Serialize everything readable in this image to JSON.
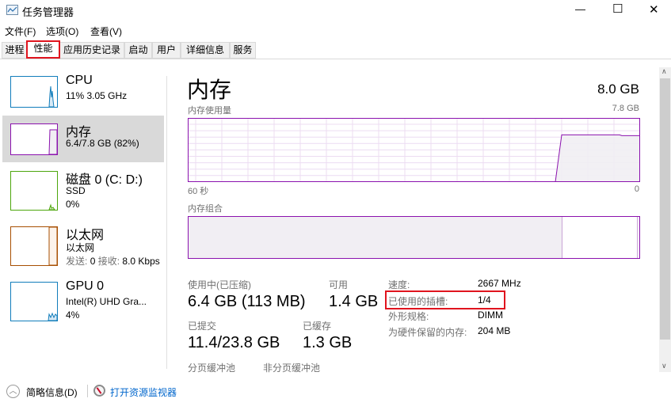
{
  "window": {
    "title": "任务管理器",
    "minimize": "—",
    "maximize": "☐",
    "close": "✕"
  },
  "menu": [
    "文件(F)",
    "选项(O)",
    "查看(V)"
  ],
  "tabs": [
    "进程",
    "性能",
    "应用历史记录",
    "启动",
    "用户",
    "详细信息",
    "服务"
  ],
  "sidebar": [
    {
      "title": "CPU",
      "sub": "11% 3.05 GHz",
      "color": "#117dbb"
    },
    {
      "title": "内存",
      "sub": "6.4/7.8 GB (82%)",
      "color": "#8b12ae"
    },
    {
      "title": "磁盘 0 (C: D:)",
      "sub": "SSD",
      "sub2": "0%",
      "color": "#4da60c"
    },
    {
      "title": "以太网",
      "sub": "以太网",
      "sub2_label1": "发送:",
      "sub2_val1": "0",
      "sub2_label2": "接收:",
      "sub2_val2": "8.0 Kbps",
      "color": "#a74f01"
    },
    {
      "title": "GPU 0",
      "sub": "Intel(R) UHD Gra...",
      "sub2": "4%",
      "color": "#117dbb"
    }
  ],
  "main": {
    "title": "内存",
    "total": "8.0 GB",
    "usage_label": "内存使用量",
    "usage_max": "7.8 GB",
    "time_left": "60 秒",
    "time_right": "0",
    "composition_label": "内存组合",
    "in_use_fraction": 0.82,
    "stats": {
      "in_use_label": "使用中(已压缩)",
      "in_use": "6.4 GB (113 MB)",
      "available_label": "可用",
      "available": "1.4 GB",
      "committed_label": "已提交",
      "committed": "11.4/23.8 GB",
      "cached_label": "已缓存",
      "cached": "1.3 GB",
      "paged_label": "分页缓冲池",
      "nonpaged_label": "非分页缓冲池"
    },
    "details": [
      {
        "label": "速度:",
        "value": "2667 MHz"
      },
      {
        "label": "已使用的插槽:",
        "value": "1/4"
      },
      {
        "label": "外形规格:",
        "value": "DIMM"
      },
      {
        "label": "为硬件保留的内存:",
        "value": "204 MB"
      }
    ]
  },
  "footer": {
    "fewer_details": "简略信息(D)",
    "open_monitor": "打开资源监视器"
  }
}
